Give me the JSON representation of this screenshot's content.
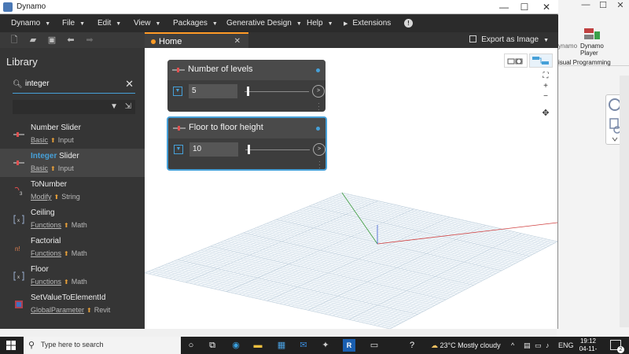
{
  "window": {
    "title": "Dynamo",
    "minimize": "—",
    "maximize": "☐",
    "close": "✕"
  },
  "menu": [
    "Dynamo",
    "File",
    "Edit",
    "View",
    "Packages",
    "Generative Design",
    "Help",
    "Extensions"
  ],
  "tabs": {
    "home_label": "Home",
    "close": "✕",
    "export_label": "Export as Image"
  },
  "library": {
    "title": "Library",
    "search_value": "integer",
    "items": [
      {
        "icon": "number-slider-icon",
        "name": "Number Slider",
        "name_pre": "",
        "name_hl": "",
        "name_post": "",
        "category": "Basic",
        "subcategory": "Input"
      },
      {
        "icon": "integer-slider-icon",
        "name": "",
        "name_pre": "",
        "name_hl": "Integer",
        "name_post": " Slider",
        "category": "Basic",
        "subcategory": "Input"
      },
      {
        "icon": "tonumber-icon",
        "name": "ToNumber",
        "name_pre": "",
        "name_hl": "",
        "name_post": "",
        "category": "Modify",
        "subcategory": "String"
      },
      {
        "icon": "ceiling-icon",
        "name": "Ceiling",
        "name_pre": "",
        "name_hl": "",
        "name_post": "",
        "category": "Functions",
        "subcategory": "Math"
      },
      {
        "icon": "factorial-icon",
        "name": "Factorial",
        "name_pre": "",
        "name_hl": "",
        "name_post": "",
        "category": "Functions",
        "subcategory": "Math"
      },
      {
        "icon": "floor-icon",
        "name": "Floor",
        "name_pre": "",
        "name_hl": "",
        "name_post": "",
        "category": "Functions",
        "subcategory": "Math"
      },
      {
        "icon": "setvalue-icon",
        "name": "SetValueToElementId",
        "name_pre": "",
        "name_hl": "",
        "name_post": "",
        "category": "GlobalParameter",
        "subcategory": "Revit"
      }
    ]
  },
  "nodes": [
    {
      "title": "Number of levels",
      "value": "5",
      "selected": false
    },
    {
      "title": "Floor to floor height",
      "value": "10",
      "selected": true
    }
  ],
  "canvas_tools": {
    "fit": "⛶",
    "zoom_in": "+",
    "zoom_out": "−",
    "pan": "✥"
  },
  "revit_bg": {
    "dynamo_label": "ynamo",
    "player_label": "Dynamo Player",
    "vp_label": "isual Programming"
  },
  "taskbar": {
    "search_placeholder": "Type here to search",
    "weather": "23°C  Mostly cloudy",
    "lang": "ENG",
    "time": "19:12",
    "date": "04-11-2022",
    "notif_count": "2"
  }
}
